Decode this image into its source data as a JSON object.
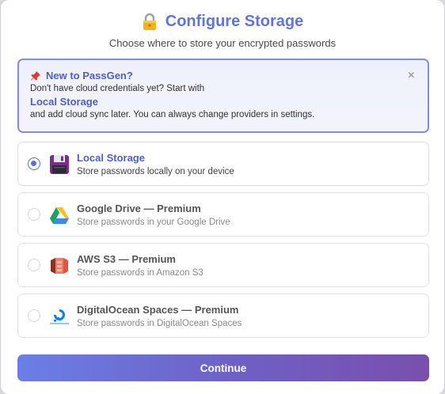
{
  "header": {
    "title": "Configure Storage",
    "subtitle": "Choose where to store your encrypted passwords",
    "icon": "lock-icon"
  },
  "notice": {
    "icon": "pushpin-icon",
    "title": "New to PassGen?",
    "line1": "Don't have cloud credentials yet? Start with",
    "link": "Local Storage",
    "line2": "and add cloud sync later. You can always change providers in settings.",
    "close": "×"
  },
  "options": [
    {
      "icon": "floppy-disk-icon",
      "title": "Local Storage",
      "desc": "Store passwords locally on your device",
      "selected": true
    },
    {
      "icon": "google-drive-icon",
      "title": "Google Drive — Premium",
      "desc": "Store passwords in your Google Drive",
      "selected": false
    },
    {
      "icon": "aws-s3-icon",
      "title": "AWS S3 — Premium",
      "desc": "Store passwords in Amazon S3",
      "selected": false
    },
    {
      "icon": "digitalocean-icon",
      "title": "DigitalOcean Spaces — Premium",
      "desc": "Store passwords in DigitalOcean Spaces",
      "selected": false
    }
  ],
  "footer": {
    "continue_label": "Continue"
  },
  "colors": {
    "accent": "#6075d9",
    "button_start": "#6a7fe6",
    "button_end": "#7a4fae"
  }
}
